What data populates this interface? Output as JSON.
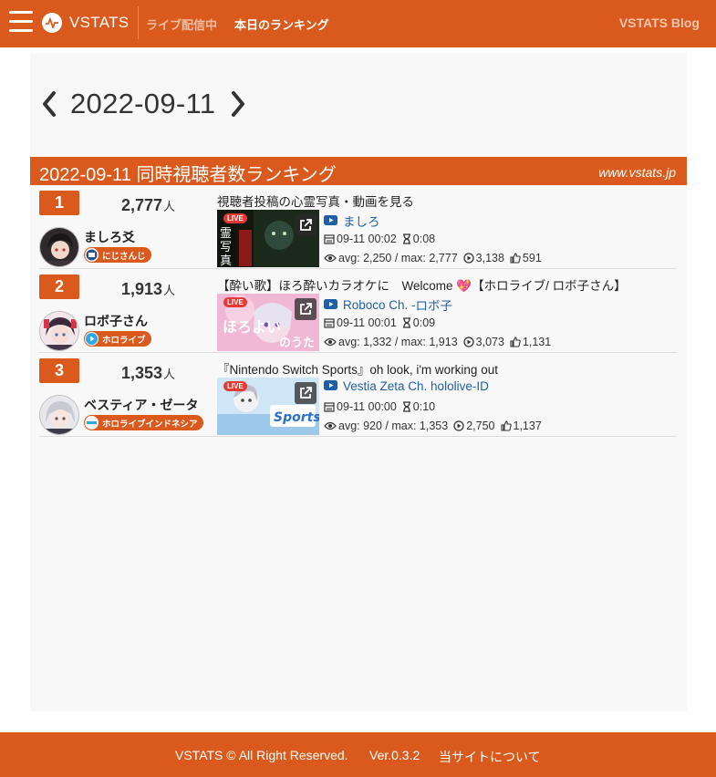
{
  "nav": {
    "brand": "VSTATS",
    "live_link": "ライブ配信中",
    "ranking_link": "本日のランキング",
    "blog_link": "VSTATS Blog"
  },
  "date_nav": {
    "date": "2022-09-11"
  },
  "ranking": {
    "title": "2022-09-11 同時視聴者数ランキング",
    "site": "www.vstats.jp",
    "rows": [
      {
        "rank": "1",
        "viewers": "2,777",
        "unit": "人",
        "channel_name": "ましろ爻",
        "org": "にじさんじ",
        "stream_title": "視聴者投稿の心霊写真・動画を見る",
        "channel_label": "ましろ",
        "talent_label": "",
        "start_time": "09-11 00:02",
        "duration": "0:08",
        "viewer_stats": "avg: 2,250 / max: 2,777",
        "views": "3,138",
        "likes": "591",
        "live_tag": "LIVE"
      },
      {
        "rank": "2",
        "viewers": "1,913",
        "unit": "人",
        "channel_name": "ロボ子さん",
        "org": "ホロライブ",
        "stream_title": "【酔い歌】ほろ酔いカラオケに　Welcome 💖【ホロライブ/ ロボ子さん】",
        "channel_label": "Roboco Ch. - ",
        "talent_label": "ロボ子",
        "start_time": "09-11 00:01",
        "duration": "0:09",
        "viewer_stats": "avg: 1,332 / max: 1,913",
        "views": "3,073",
        "likes": "1,131",
        "live_tag": "LIVE"
      },
      {
        "rank": "3",
        "viewers": "1,353",
        "unit": "人",
        "channel_name": "ベスティア・ゼータ",
        "org": "ホロライブインドネシア",
        "stream_title": "『Nintendo Switch Sports』oh look, i'm working out",
        "channel_label": "Vestia Zeta Ch. hololive-ID",
        "talent_label": "",
        "start_time": "09-11 00:00",
        "duration": "0:10",
        "viewer_stats": "avg: 920 / max: 1,353",
        "views": "2,750",
        "likes": "1,137",
        "live_tag": "LIVE"
      }
    ]
  },
  "footer": {
    "copyright": "VSTATS © All Right Reserved.",
    "version": "Ver.0.3.2",
    "about": "当サイトについて"
  },
  "colors": {
    "brand": "#d95a1c",
    "link": "#1f5fa8",
    "youtube": "#e53935"
  },
  "icons": [
    "menu-icon",
    "pulse-logo-icon",
    "chevron-left-icon",
    "chevron-right-icon",
    "youtube-icon",
    "calendar-icon",
    "hourglass-icon",
    "eye-icon",
    "play-circle-icon",
    "thumbs-up-icon",
    "external-link-icon"
  ]
}
